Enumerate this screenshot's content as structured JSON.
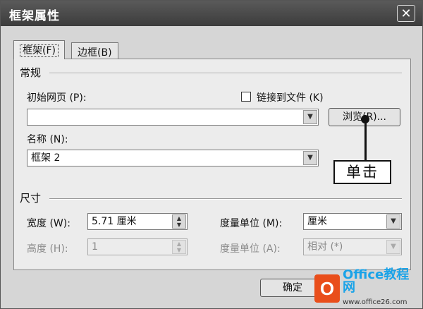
{
  "dialog": {
    "title": "框架属性",
    "close_glyph": "✕"
  },
  "tabs": [
    {
      "label": "框架",
      "key": "(F)"
    },
    {
      "label": "边框",
      "key": "(B)"
    }
  ],
  "general": {
    "group_label": "常规",
    "initial_page_label": "初始网页 (P):",
    "initial_page_value": "",
    "link_to_file_label": "链接到文件 (K)",
    "link_to_file_checked": false,
    "browse_label": "浏览(R)...",
    "name_label": "名称 (N):",
    "name_value": "框架 2"
  },
  "size": {
    "group_label": "尺寸",
    "width_label": "宽度 (W):",
    "width_value": "5.71 厘米",
    "width_unit_label": "度量单位 (M):",
    "width_unit_value": "厘米",
    "height_label": "高度 (H):",
    "height_value": "1",
    "height_unit_label": "度量单位 (A):",
    "height_unit_value": "相对 (*)"
  },
  "footer": {
    "ok_label": "确定"
  },
  "annotation": {
    "callout_text": "单击"
  },
  "watermark": {
    "text": "Office教程网",
    "url": "www.office26.com"
  },
  "icons": {
    "dropdown_arrow": "▼",
    "spin_up": "▲",
    "spin_down": "▼"
  }
}
